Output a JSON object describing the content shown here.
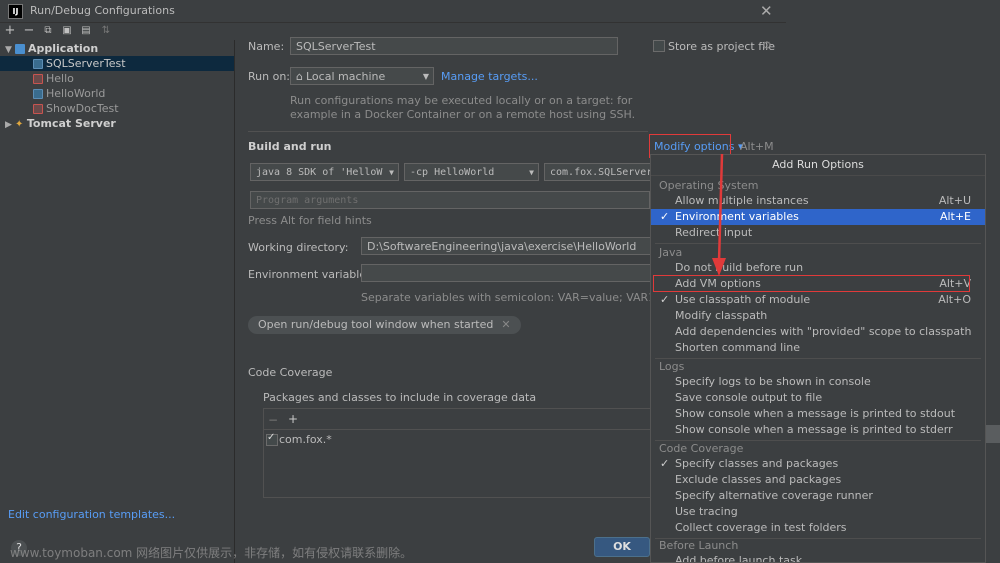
{
  "window": {
    "title": "Run/Debug Configurations",
    "app_icon_text": "IJ"
  },
  "toolbar": {
    "buttons": [
      "add",
      "remove",
      "copy",
      "save",
      "move",
      "sort"
    ]
  },
  "tree": {
    "items": [
      {
        "label": "Application",
        "kind": "category",
        "expanded": true
      },
      {
        "label": "SQLServerTest",
        "kind": "config",
        "selected": true
      },
      {
        "label": "Hello",
        "kind": "config-error"
      },
      {
        "label": "HelloWorld",
        "kind": "config"
      },
      {
        "label": "ShowDocTest",
        "kind": "config-error"
      },
      {
        "label": "Tomcat Server",
        "kind": "category",
        "expanded": false
      }
    ]
  },
  "edit_templates_link": "Edit configuration templates...",
  "help_label": "?",
  "form": {
    "name_label": "Name:",
    "name_value": "SQLServerTest",
    "store_label": "Store as project file",
    "run_on_label": "Run on:",
    "run_on_value": "Local machine",
    "manage_targets": "Manage targets...",
    "run_on_hint_1": "Run configurations may be executed locally or on a target: for",
    "run_on_hint_2": "example in a Docker Container or on a remote host using SSH.",
    "build_run_title": "Build and run",
    "modify_options": "Modify options",
    "modify_shortcut": "Alt+M",
    "sdk_value": "java 8 SDK of 'HelloW",
    "cp_value": "-cp HelloWorld",
    "main_class_value": "com.fox.SQLServer",
    "program_args_placeholder": "Program arguments",
    "field_hint": "Press Alt for field hints",
    "working_dir_label": "Working directory:",
    "working_dir_value": "D:\\SoftwareEngineering\\java\\exercise\\HelloWorld",
    "env_label": "Environment variables:",
    "env_hint": "Separate variables with semicolon: VAR=value; VAR1=value1",
    "open_tool_window_pill": "Open run/debug tool window when started",
    "code_coverage_title": "Code Coverage",
    "packages_label": "Packages and classes to include in coverage data",
    "coverage_entry": "com.fox.*",
    "ok_button": "OK"
  },
  "popup": {
    "title": "Add Run Options",
    "groups": [
      {
        "name": "Operating System",
        "items": [
          {
            "label": "Allow multiple instances",
            "shortcut": "Alt+U",
            "checked": false
          },
          {
            "label": "Environment variables",
            "shortcut": "Alt+E",
            "checked": true,
            "highlighted": true
          },
          {
            "label": "Redirect input",
            "shortcut": "",
            "checked": false
          }
        ]
      },
      {
        "name": "Java",
        "items": [
          {
            "label": "Do not build before run",
            "shortcut": "",
            "checked": false
          },
          {
            "label": "Add VM options",
            "shortcut": "Alt+V",
            "checked": false
          },
          {
            "label": "Use classpath of module",
            "shortcut": "Alt+O",
            "checked": true
          },
          {
            "label": "Modify classpath",
            "shortcut": "",
            "checked": false
          },
          {
            "label": "Add dependencies with \"provided\" scope to classpath",
            "shortcut": "",
            "checked": false
          },
          {
            "label": "Shorten command line",
            "shortcut": "",
            "checked": false
          }
        ]
      },
      {
        "name": "Logs",
        "items": [
          {
            "label": "Specify logs to be shown in console",
            "shortcut": "",
            "checked": false
          },
          {
            "label": "Save console output to file",
            "shortcut": "",
            "checked": false
          },
          {
            "label": "Show console when a message is printed to stdout",
            "shortcut": "",
            "checked": false
          },
          {
            "label": "Show console when a message is printed to stderr",
            "shortcut": "",
            "checked": false
          }
        ]
      },
      {
        "name": "Code Coverage",
        "items": [
          {
            "label": "Specify classes and packages",
            "shortcut": "",
            "checked": true
          },
          {
            "label": "Exclude classes and packages",
            "shortcut": "",
            "checked": false
          },
          {
            "label": "Specify alternative coverage runner",
            "shortcut": "",
            "checked": false
          },
          {
            "label": "Use tracing",
            "shortcut": "",
            "checked": false
          },
          {
            "label": "Collect coverage in test folders",
            "shortcut": "",
            "checked": false
          }
        ]
      },
      {
        "name": "Before Launch",
        "items": [
          {
            "label": "Add before launch task",
            "shortcut": "",
            "checked": false
          }
        ]
      }
    ]
  },
  "watermark": "www.toymoban.com 网络图片仅供展示，非存储，如有侵权请联系删除。",
  "colors": {
    "accent": "#589df6",
    "highlight": "#2f65ca",
    "annotation_red": "#e03a3a",
    "ok_button": "#365880"
  }
}
